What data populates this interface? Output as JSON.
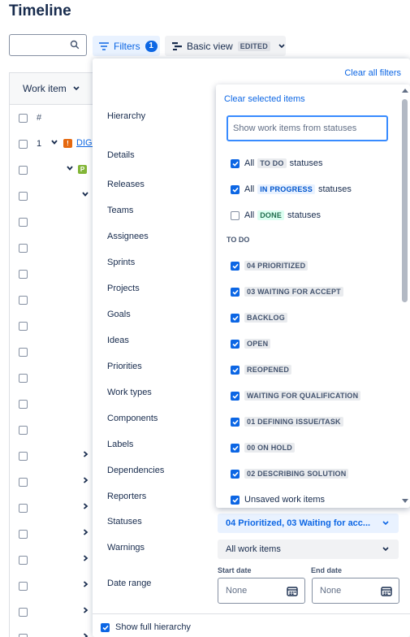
{
  "page": {
    "title": "Timeline"
  },
  "toolbar": {
    "search_value": "",
    "filters_label": "Filters",
    "filters_count": "1",
    "view_label": "Basic view",
    "view_badge": "EDITED"
  },
  "table": {
    "header_label": "Work item",
    "hash_label": "#",
    "first_row_number": "1",
    "first_row_link": "DIGI",
    "second_row_badge": "P"
  },
  "filter_panel": {
    "clear_all_label": "Clear all filters",
    "filters": [
      "Hierarchy",
      "Details",
      "Releases",
      "Teams",
      "Assignees",
      "Sprints",
      "Projects",
      "Goals",
      "Ideas",
      "Priorities",
      "Work types",
      "Components",
      "Labels",
      "Dependencies",
      "Reporters",
      "Statuses",
      "Warnings",
      "Date range"
    ],
    "statuses_value": "04 Prioritized, 03 Waiting for acc...",
    "warnings_value": "All work items",
    "start_date_label": "Start date",
    "end_date_label": "End date",
    "start_date_placeholder": "None",
    "end_date_placeholder": "None",
    "show_full_hierarchy_label": "Show full hierarchy",
    "show_full_hierarchy_checked": true
  },
  "status_dropdown": {
    "clear_selected_label": "Clear selected items",
    "search_placeholder": "Show work items from statuses",
    "category_options": [
      {
        "prefix": "All",
        "lozenge": "TO DO",
        "suffix": "statuses",
        "color": "grey",
        "checked": true
      },
      {
        "prefix": "All",
        "lozenge": "IN PROGRESS",
        "suffix": "statuses",
        "color": "blue",
        "checked": true
      },
      {
        "prefix": "All",
        "lozenge": "DONE",
        "suffix": "statuses",
        "color": "green",
        "checked": false
      }
    ],
    "group_heading": "TO DO",
    "status_options": [
      {
        "label": "04 PRIORITIZED",
        "checked": true
      },
      {
        "label": "03 WAITING FOR ACCEPT",
        "checked": true
      },
      {
        "label": "BACKLOG",
        "checked": true
      },
      {
        "label": "OPEN",
        "checked": true
      },
      {
        "label": "REOPENED",
        "checked": true
      },
      {
        "label": "WAITING FOR QUALIFICATION",
        "checked": true
      },
      {
        "label": "01 DEFINING ISSUE/TASK",
        "checked": true
      },
      {
        "label": "00 ON HOLD",
        "checked": true
      },
      {
        "label": "02 DESCRIBING SOLUTION",
        "checked": true
      }
    ],
    "unsaved_label": "Unsaved work items",
    "unsaved_checked": true
  },
  "colors": {
    "accent": "#0c66e4",
    "priority_high": "#e56910",
    "badge_green": "#82b536"
  }
}
